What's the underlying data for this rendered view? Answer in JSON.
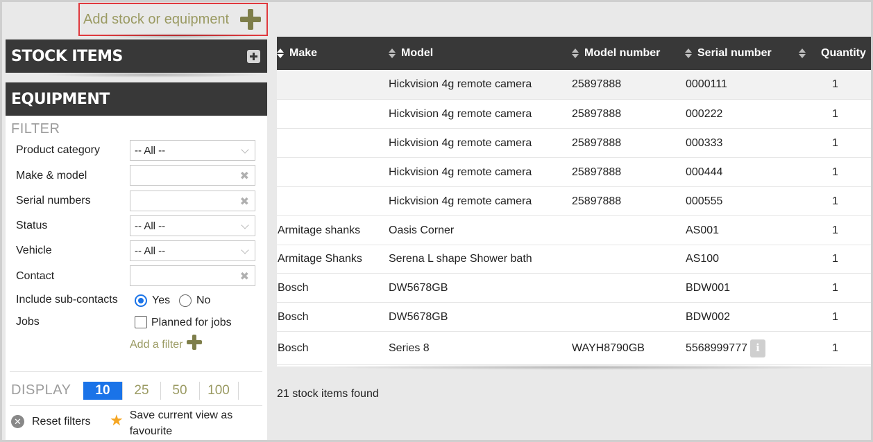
{
  "add_stock_label": "Add stock or equipment",
  "sidebar": {
    "stock_items_title": "STOCK ITEMS",
    "equipment_title": "EQUIPMENT",
    "filter_title": "FILTER",
    "filters": {
      "product_category": {
        "label": "Product category",
        "value": "-- All --"
      },
      "make_model": {
        "label": "Make & model",
        "value": ""
      },
      "serial_numbers": {
        "label": "Serial numbers",
        "value": ""
      },
      "status": {
        "label": "Status",
        "value": "-- All --"
      },
      "vehicle": {
        "label": "Vehicle",
        "value": "-- All --"
      },
      "contact": {
        "label": "Contact",
        "value": ""
      },
      "include_sub_contacts": {
        "label": "Include sub-contacts",
        "yes": "Yes",
        "no": "No",
        "selected": "Yes"
      },
      "jobs": {
        "label": "Jobs",
        "option": "Planned for jobs",
        "checked": false
      }
    },
    "add_filter_label": "Add a filter",
    "display_label": "DISPLAY",
    "page_sizes": [
      "10",
      "25",
      "50",
      "100"
    ],
    "page_size_selected": "10",
    "reset_label": "Reset filters",
    "save_view_label": "Save current view as favourite"
  },
  "table": {
    "columns": [
      "Make",
      "Model",
      "Model number",
      "Serial number",
      "Quantity"
    ],
    "rows": [
      {
        "make": "",
        "model": "Hickvision 4g remote camera",
        "model_number": "25897888",
        "serial": "0000111",
        "qty": "1"
      },
      {
        "make": "",
        "model": "Hickvision 4g remote camera",
        "model_number": "25897888",
        "serial": "000222",
        "qty": "1"
      },
      {
        "make": "",
        "model": "Hickvision 4g remote camera",
        "model_number": "25897888",
        "serial": "000333",
        "qty": "1"
      },
      {
        "make": "",
        "model": "Hickvision 4g remote camera",
        "model_number": "25897888",
        "serial": "000444",
        "qty": "1"
      },
      {
        "make": "",
        "model": "Hickvision 4g remote camera",
        "model_number": "25897888",
        "serial": "000555",
        "qty": "1"
      },
      {
        "make": "Armitage shanks",
        "model": "Oasis Corner",
        "model_number": "",
        "serial": "AS001",
        "qty": "1"
      },
      {
        "make": "Armitage Shanks",
        "model": "Serena L shape Shower bath",
        "model_number": "",
        "serial": "AS100",
        "qty": "1"
      },
      {
        "make": "Bosch",
        "model": "DW5678GB",
        "model_number": "",
        "serial": "BDW001",
        "qty": "1"
      },
      {
        "make": "Bosch",
        "model": "DW5678GB",
        "model_number": "",
        "serial": "BDW002",
        "qty": "1"
      },
      {
        "make": "Bosch",
        "model": "Series 8",
        "model_number": "WAYH8790GB",
        "serial": "5568999777",
        "qty": "1"
      }
    ],
    "result_count": "21 stock items found"
  },
  "colors": {
    "header_bg": "#383838",
    "accent_blue": "#1a73e8",
    "olive_link": "#9a9a62",
    "highlight_border": "#e0393e"
  }
}
